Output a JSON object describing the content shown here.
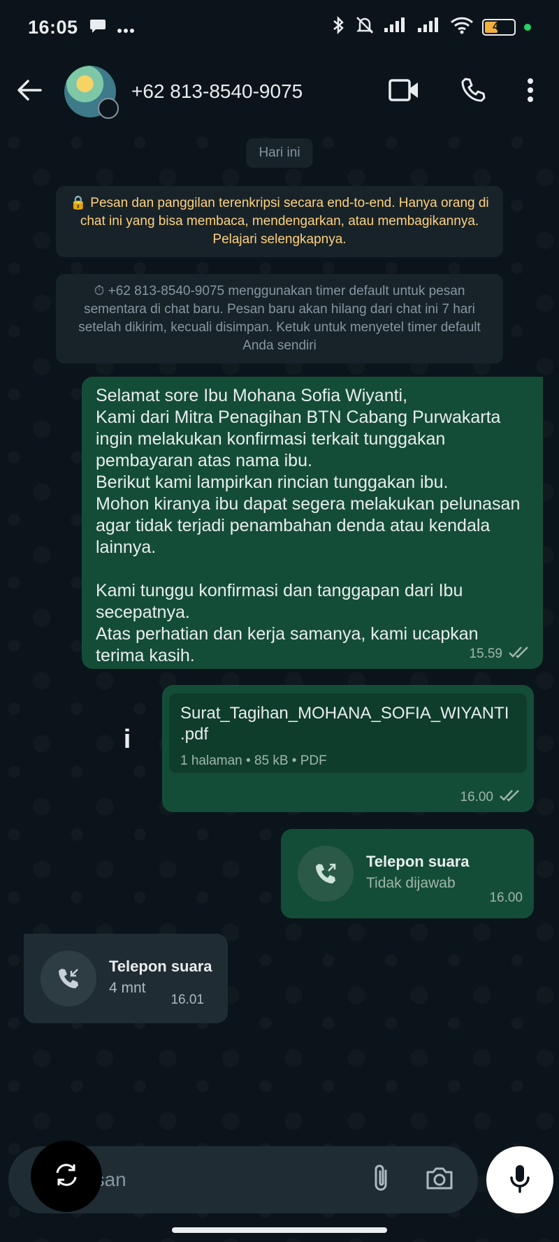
{
  "status_bar": {
    "time": "16:05",
    "battery": "45",
    "colors": {
      "battery_fill": "#f2b03c",
      "online_dot": "#25d366"
    }
  },
  "header": {
    "contact_name": "+62 813-8540-9075",
    "icons": [
      "back-arrow-icon",
      "video-call-icon",
      "voice-call-icon",
      "more-options-icon"
    ]
  },
  "chat": {
    "date_chip": "Hari ini",
    "encryption_notice": "🔒 Pesan dan panggilan terenkripsi secara end-to-end. Hanya orang di chat ini yang bisa membaca, mendengarkan, atau membagikannya. Pelajari selengkapnya.",
    "timer_notice": "⏱ +62 813-8540-9075 menggunakan timer default untuk pesan sementara di chat baru. Pesan baru akan hilang dari chat ini 7 hari setelah dikirim, kecuali disimpan. Ketuk untuk menyetel timer default Anda sendiri",
    "messages": [
      {
        "type": "text",
        "direction": "out",
        "text": "Selamat sore Ibu Mohana Sofia Wiyanti,\nKami dari Mitra Penagihan BTN Cabang Purwakarta ingin melakukan konfirmasi terkait tunggakan pembayaran atas nama ibu.\nBerikut kami lampirkan rincian tunggakan ibu.\nMohon kiranya ibu dapat segera melakukan pelunasan agar tidak terjadi penambahan denda atau kendala lainnya.\n\nKami tunggu konfirmasi dan tanggapan dari Ibu secepatnya.\nAtas perhatian dan kerja samanya, kami ucapkan terima kasih.",
        "time": "15.59"
      },
      {
        "type": "document",
        "direction": "out",
        "file_name": "Surat_Tagihan_MOHANA_SOFIA_WIYANTI\n.pdf",
        "file_info": "1 halaman • 85 kB • PDF",
        "time": "16.00"
      },
      {
        "type": "call",
        "direction": "out",
        "title": "Telepon suara",
        "subtitle": "Tidak dijawab",
        "time": "16.00"
      },
      {
        "type": "call",
        "direction": "in",
        "title": "Telepon suara",
        "subtitle": "4 mnt",
        "time": "16.01"
      }
    ],
    "colors": {
      "outgoing_bubble": "#144d37",
      "incoming_bubble": "#202c33",
      "encryption_text": "#ffd279"
    }
  },
  "composer": {
    "placeholder": "esan"
  }
}
